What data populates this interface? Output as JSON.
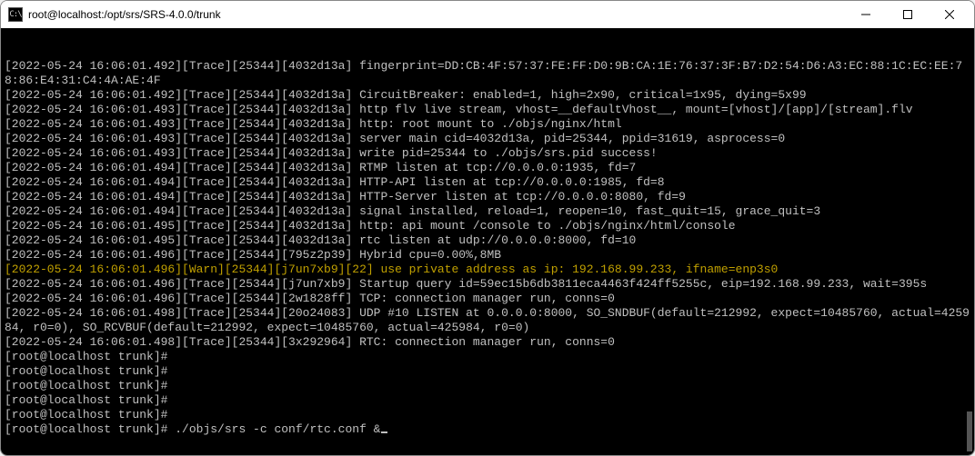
{
  "window": {
    "title": "root@localhost:/opt/srs/SRS-4.0.0/trunk",
    "icon_label": "C:\\"
  },
  "terminal": {
    "lines": [
      {
        "cls": "",
        "text": "[2022-05-24 16:06:01.492][Trace][25344][4032d13a] fingerprint=DD:CB:4F:57:37:FE:FF:D0:9B:CA:1E:76:37:3F:B7:D2:54:D6:A3:EC:88:1C:EC:EE:78:86:E4:31:C4:4A:AE:4F"
      },
      {
        "cls": "",
        "text": "[2022-05-24 16:06:01.492][Trace][25344][4032d13a] CircuitBreaker: enabled=1, high=2x90, critical=1x95, dying=5x99"
      },
      {
        "cls": "",
        "text": "[2022-05-24 16:06:01.493][Trace][25344][4032d13a] http flv live stream, vhost=__defaultVhost__, mount=[vhost]/[app]/[stream].flv"
      },
      {
        "cls": "",
        "text": "[2022-05-24 16:06:01.493][Trace][25344][4032d13a] http: root mount to ./objs/nginx/html"
      },
      {
        "cls": "",
        "text": "[2022-05-24 16:06:01.493][Trace][25344][4032d13a] server main cid=4032d13a, pid=25344, ppid=31619, asprocess=0"
      },
      {
        "cls": "",
        "text": "[2022-05-24 16:06:01.493][Trace][25344][4032d13a] write pid=25344 to ./objs/srs.pid success!"
      },
      {
        "cls": "",
        "text": "[2022-05-24 16:06:01.494][Trace][25344][4032d13a] RTMP listen at tcp://0.0.0.0:1935, fd=7"
      },
      {
        "cls": "",
        "text": "[2022-05-24 16:06:01.494][Trace][25344][4032d13a] HTTP-API listen at tcp://0.0.0.0:1985, fd=8"
      },
      {
        "cls": "",
        "text": "[2022-05-24 16:06:01.494][Trace][25344][4032d13a] HTTP-Server listen at tcp://0.0.0.0:8080, fd=9"
      },
      {
        "cls": "",
        "text": "[2022-05-24 16:06:01.494][Trace][25344][4032d13a] signal installed, reload=1, reopen=10, fast_quit=15, grace_quit=3"
      },
      {
        "cls": "",
        "text": "[2022-05-24 16:06:01.495][Trace][25344][4032d13a] http: api mount /console to ./objs/nginx/html/console"
      },
      {
        "cls": "",
        "text": "[2022-05-24 16:06:01.495][Trace][25344][4032d13a] rtc listen at udp://0.0.0.0:8000, fd=10"
      },
      {
        "cls": "",
        "text": "[2022-05-24 16:06:01.496][Trace][25344][795z2p39] Hybrid cpu=0.00%,8MB"
      },
      {
        "cls": "warn",
        "text": "[2022-05-24 16:06:01.496][Warn][25344][j7un7xb9][22] use private address as ip: 192.168.99.233, ifname=enp3s0"
      },
      {
        "cls": "",
        "text": "[2022-05-24 16:06:01.496][Trace][25344][j7un7xb9] Startup query id=59ec15b6db3811eca4463f424ff5255c, eip=192.168.99.233, wait=395s"
      },
      {
        "cls": "",
        "text": "[2022-05-24 16:06:01.496][Trace][25344][2w1828ff] TCP: connection manager run, conns=0"
      },
      {
        "cls": "",
        "text": "[2022-05-24 16:06:01.498][Trace][25344][20o24083] UDP #10 LISTEN at 0.0.0.0:8000, SO_SNDBUF(default=212992, expect=10485760, actual=425984, r0=0), SO_RCVBUF(default=212992, expect=10485760, actual=425984, r0=0)"
      },
      {
        "cls": "",
        "text": "[2022-05-24 16:06:01.498][Trace][25344][3x292964] RTC: connection manager run, conns=0"
      },
      {
        "cls": "",
        "text": ""
      },
      {
        "cls": "",
        "text": "[root@localhost trunk]#"
      },
      {
        "cls": "",
        "text": "[root@localhost trunk]#"
      },
      {
        "cls": "",
        "text": "[root@localhost trunk]#"
      },
      {
        "cls": "",
        "text": "[root@localhost trunk]#"
      },
      {
        "cls": "",
        "text": "[root@localhost trunk]#"
      }
    ],
    "active_prompt": "[root@localhost trunk]# ",
    "active_command": "./objs/srs -c conf/rtc.conf &"
  }
}
